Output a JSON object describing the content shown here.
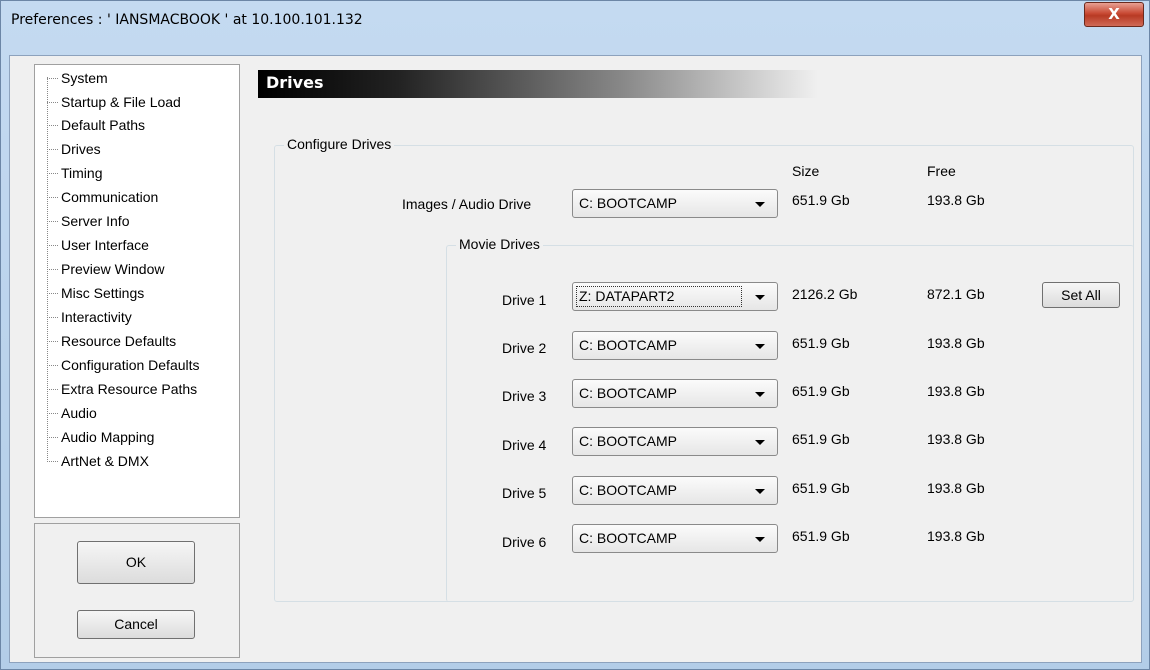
{
  "window": {
    "title": "Preferences  :  ' IANSMACBOOK '  at  10.100.101.132",
    "close_glyph": "X"
  },
  "nav": {
    "items": [
      {
        "label": "System"
      },
      {
        "label": "Startup & File Load"
      },
      {
        "label": "Default Paths"
      },
      {
        "label": "Drives",
        "selected": true
      },
      {
        "label": "Timing"
      },
      {
        "label": "Communication"
      },
      {
        "label": "Server Info"
      },
      {
        "label": "User Interface"
      },
      {
        "label": "Preview Window"
      },
      {
        "label": "Misc Settings"
      },
      {
        "label": "Interactivity"
      },
      {
        "label": "Resource Defaults"
      },
      {
        "label": "Configuration Defaults"
      },
      {
        "label": "Extra Resource Paths"
      },
      {
        "label": "Audio"
      },
      {
        "label": "Audio Mapping"
      },
      {
        "label": "ArtNet & DMX"
      }
    ]
  },
  "buttons": {
    "ok": "OK",
    "cancel": "Cancel",
    "set_all": "Set All"
  },
  "panel": {
    "header": "Drives",
    "configure_legend": "Configure Drives",
    "col_size": "Size",
    "col_free": "Free",
    "images_audio": {
      "label": "Images / Audio Drive",
      "value": "C:  BOOTCAMP",
      "size": "651.9 Gb",
      "free": "193.8 Gb"
    },
    "movie_legend": "Movie Drives",
    "movie_drives": [
      {
        "label": "Drive 1",
        "value": "Z:  DATAPART2",
        "size": "2126.2 Gb",
        "free": "872.1 Gb"
      },
      {
        "label": "Drive 2",
        "value": "C:  BOOTCAMP",
        "size": "651.9 Gb",
        "free": "193.8 Gb"
      },
      {
        "label": "Drive 3",
        "value": "C:  BOOTCAMP",
        "size": "651.9 Gb",
        "free": "193.8 Gb"
      },
      {
        "label": "Drive 4",
        "value": "C:  BOOTCAMP",
        "size": "651.9 Gb",
        "free": "193.8 Gb"
      },
      {
        "label": "Drive 5",
        "value": "C:  BOOTCAMP",
        "size": "651.9 Gb",
        "free": "193.8 Gb"
      },
      {
        "label": "Drive 6",
        "value": "C:  BOOTCAMP",
        "size": "651.9 Gb",
        "free": "193.8 Gb"
      }
    ]
  }
}
